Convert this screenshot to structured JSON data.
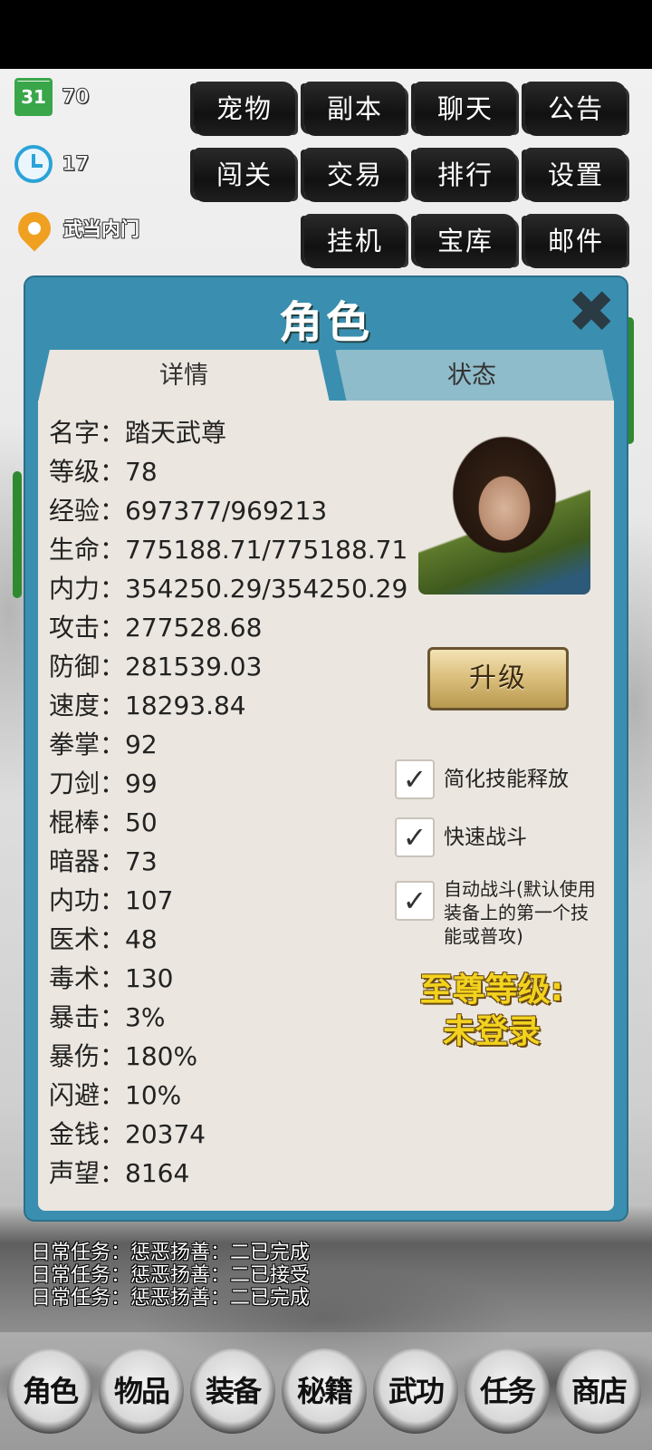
{
  "header": {
    "days": "70",
    "timer": "17",
    "location": "武当内门"
  },
  "menu": [
    {
      "label": "宠物"
    },
    {
      "label": "副本"
    },
    {
      "label": "聊天"
    },
    {
      "label": "公告"
    },
    {
      "label": "闯关"
    },
    {
      "label": "交易"
    },
    {
      "label": "排行"
    },
    {
      "label": "设置"
    },
    {
      "label": "挂机"
    },
    {
      "label": "宝库"
    },
    {
      "label": "邮件"
    }
  ],
  "panel": {
    "title": "角色",
    "close_icon": "close-icon",
    "tabs": [
      {
        "label": "详情"
      },
      {
        "label": "状态"
      }
    ],
    "stats": [
      {
        "label": "名字：",
        "value": "踏天武尊"
      },
      {
        "label": "等级：",
        "value": "78"
      },
      {
        "label": "经验：",
        "value": "697377/969213"
      },
      {
        "label": "生命：",
        "value": "775188.71/775188.71"
      },
      {
        "label": "内力：",
        "value": "354250.29/354250.29"
      },
      {
        "label": "攻击：",
        "value": "277528.68"
      },
      {
        "label": "防御：",
        "value": "281539.03"
      },
      {
        "label": "速度：",
        "value": "18293.84"
      },
      {
        "label": "拳掌：",
        "value": "92"
      },
      {
        "label": "刀剑：",
        "value": "99"
      },
      {
        "label": "棍棒：",
        "value": "50"
      },
      {
        "label": "暗器：",
        "value": "73"
      },
      {
        "label": "内功：",
        "value": "107"
      },
      {
        "label": "医术：",
        "value": "48"
      },
      {
        "label": "毒术：",
        "value": "130"
      },
      {
        "label": "暴击：",
        "value": "3%"
      },
      {
        "label": "暴伤：",
        "value": "180%"
      },
      {
        "label": "闪避：",
        "value": "10%"
      },
      {
        "label": "金钱：",
        "value": "20374"
      },
      {
        "label": "声望：",
        "value": "8164"
      }
    ],
    "upgrade_label": "升级",
    "options": [
      {
        "label": "简化技能释放",
        "checked": true
      },
      {
        "label": "快速战斗",
        "checked": true
      },
      {
        "label": "自动战斗(默认使用装备上的第一个技能或普攻)",
        "checked": true
      }
    ],
    "check_mark": "✓",
    "supreme_line1": "至尊等级:",
    "supreme_line2": "未登录"
  },
  "log": [
    "日常任务：惩恶扬善：二已完成",
    "日常任务：惩恶扬善：二已接受",
    "日常任务：惩恶扬善：二已完成"
  ],
  "nav": [
    {
      "label": "角色"
    },
    {
      "label": "物品"
    },
    {
      "label": "装备"
    },
    {
      "label": "秘籍"
    },
    {
      "label": "武功"
    },
    {
      "label": "任务"
    },
    {
      "label": "商店"
    }
  ]
}
